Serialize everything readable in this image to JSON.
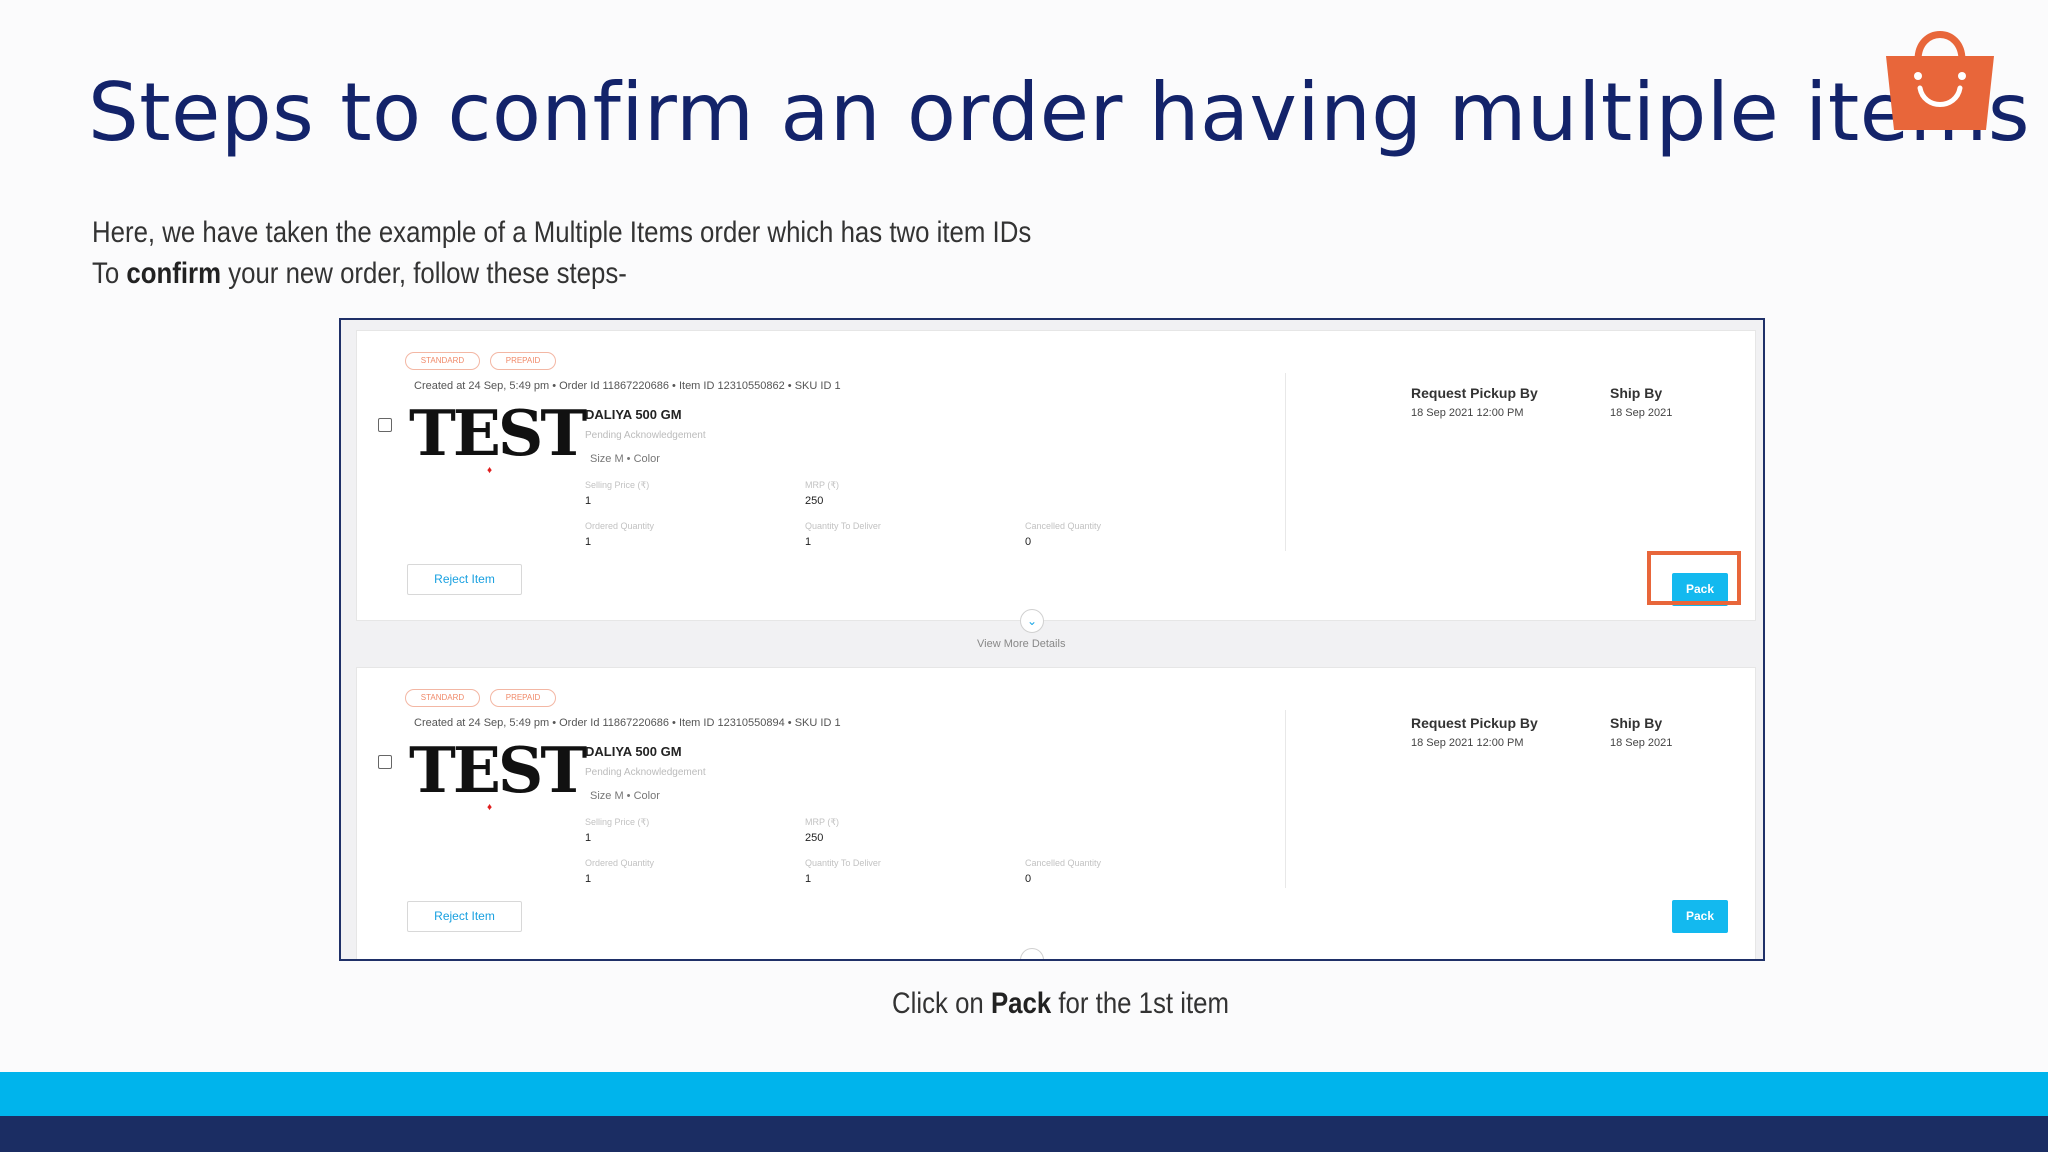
{
  "slide": {
    "title": "Steps to confirm an order having multiple items",
    "intro_line1": "Here, we have taken the example of a Multiple Items order which has two item IDs",
    "intro_line2_prefix": "To ",
    "intro_line2_bold": "confirm",
    "intro_line2_suffix": " your new order, follow these steps-",
    "caption_prefix": "Click on ",
    "caption_bold": "Pack",
    "caption_suffix": " for the 1st item",
    "brand_icon": "shopping-bag-icon",
    "colors": {
      "title": "#13236a",
      "accent_orange": "#e8663a",
      "band_light": "#00b4ec",
      "band_dark": "#1b2d63",
      "pack_button": "#13b9ef"
    }
  },
  "orders": [
    {
      "tag_standard": "STANDARD",
      "tag_prepaid": "PREPAID",
      "meta": "Created at 24 Sep, 5:49 pm •   Order Id 11867220686  •   Item ID 12310550862  •   SKU ID 1",
      "image_text": "TEST",
      "product_name": "DALIYA 500 GM",
      "status": "Pending Acknowledgement",
      "variant": "Size M  •   Color",
      "selling_price_label": "Selling Price (₹)",
      "selling_price": "1",
      "mrp_label": "MRP (₹)",
      "mrp": "250",
      "ordered_qty_label": "Ordered Quantity",
      "ordered_qty": "1",
      "qty_to_deliver_label": "Quantity To Deliver",
      "qty_to_deliver": "1",
      "cancelled_qty_label": "Cancelled Quantity",
      "cancelled_qty": "0",
      "pickup_label": "Request Pickup By",
      "pickup_value": "18 Sep 2021 12:00 PM",
      "ship_label": "Ship By",
      "ship_value": "18 Sep 2021",
      "reject_label": "Reject Item",
      "pack_label": "Pack"
    },
    {
      "tag_standard": "STANDARD",
      "tag_prepaid": "PREPAID",
      "meta": "Created at 24 Sep, 5:49 pm •   Order Id 11867220686  •   Item ID 12310550894  •   SKU ID 1",
      "image_text": "TEST",
      "product_name": "DALIYA 500 GM",
      "status": "Pending Acknowledgement",
      "variant": "Size M  •   Color",
      "selling_price_label": "Selling Price (₹)",
      "selling_price": "1",
      "mrp_label": "MRP (₹)",
      "mrp": "250",
      "ordered_qty_label": "Ordered Quantity",
      "ordered_qty": "1",
      "qty_to_deliver_label": "Quantity To Deliver",
      "qty_to_deliver": "1",
      "cancelled_qty_label": "Cancelled Quantity",
      "cancelled_qty": "0",
      "pickup_label": "Request Pickup By",
      "pickup_value": "18 Sep 2021 12:00 PM",
      "ship_label": "Ship By",
      "ship_value": "18 Sep 2021",
      "reject_label": "Reject Item",
      "pack_label": "Pack"
    }
  ],
  "view_more": "View More Details"
}
